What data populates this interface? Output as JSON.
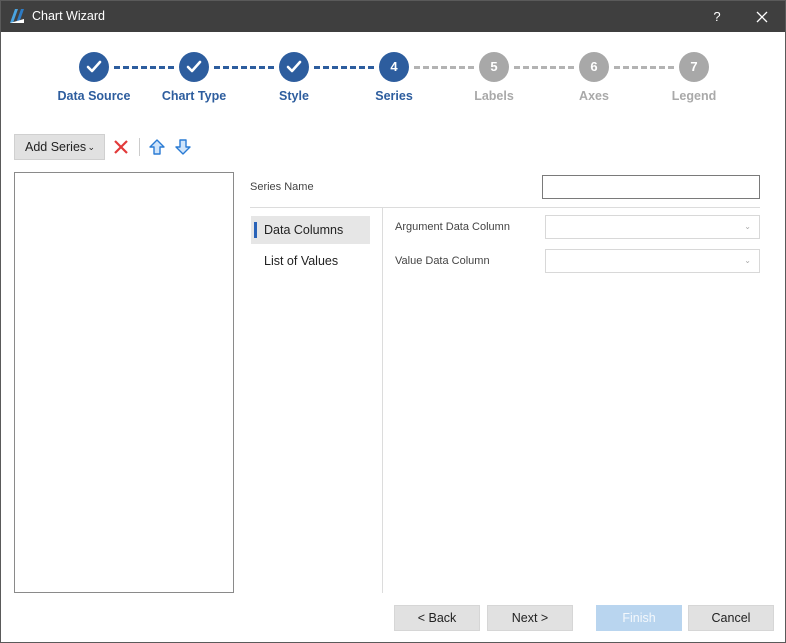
{
  "window": {
    "title": "Chart Wizard",
    "help": "?"
  },
  "colors": {
    "done": "#2d5d9e",
    "current": "#2d5d9e",
    "pending": "#a8a8a8",
    "done_label": "#2d5d9e",
    "pending_label": "#a9a9a9"
  },
  "steps": [
    {
      "num": "",
      "label": "Data Source",
      "state": "done"
    },
    {
      "num": "",
      "label": "Chart Type",
      "state": "done"
    },
    {
      "num": "",
      "label": "Style",
      "state": "done"
    },
    {
      "num": "4",
      "label": "Series",
      "state": "current"
    },
    {
      "num": "5",
      "label": "Labels",
      "state": "pending"
    },
    {
      "num": "6",
      "label": "Axes",
      "state": "pending"
    },
    {
      "num": "7",
      "label": "Legend",
      "state": "pending"
    }
  ],
  "toolbar": {
    "add_series_label": "Add Series"
  },
  "series": {
    "name_label": "Series Name",
    "name_value": ""
  },
  "nav": [
    {
      "label": "Data Columns",
      "active": true
    },
    {
      "label": "List of Values",
      "active": false
    }
  ],
  "fields": [
    {
      "label": "Argument Data Column",
      "value": ""
    },
    {
      "label": "Value Data Column",
      "value": ""
    }
  ],
  "footer": {
    "back": "< Back",
    "next": "Next >",
    "finish": "Finish",
    "cancel": "Cancel"
  }
}
